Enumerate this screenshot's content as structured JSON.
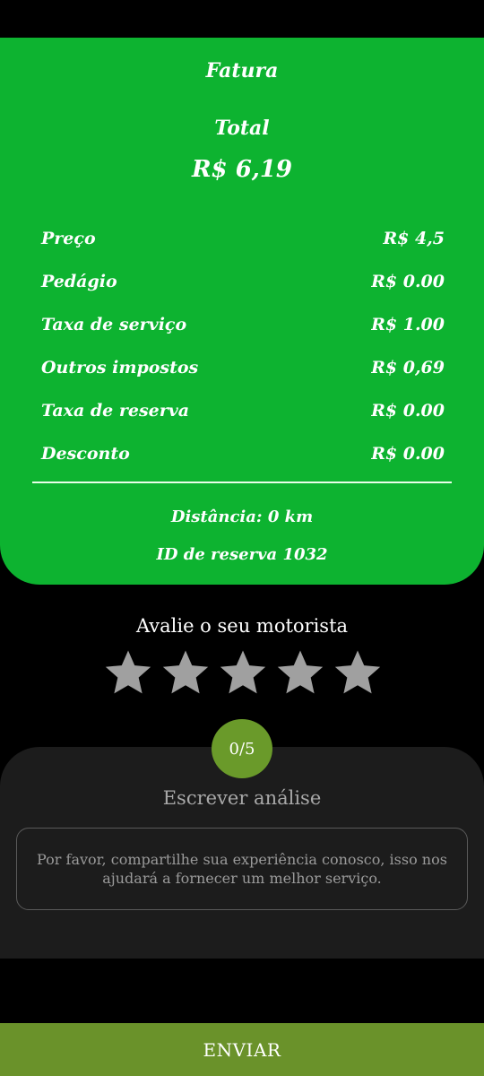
{
  "invoice": {
    "title": "Fatura",
    "total_label": "Total",
    "total_value": "R$ 6,19",
    "rows": [
      {
        "label": "Preço",
        "value": "R$ 4,5"
      },
      {
        "label": "Pedágio",
        "value": "R$ 0.00"
      },
      {
        "label": "Taxa de serviço",
        "value": "R$ 1.00"
      },
      {
        "label": "Outros impostos",
        "value": "R$ 0,69"
      },
      {
        "label": "Taxa de reserva",
        "value": "R$ 0.00"
      },
      {
        "label": "Desconto",
        "value": "R$ 0.00"
      }
    ],
    "distance": "Distância: 0 km",
    "booking_id": "ID de reserva 1032"
  },
  "rating": {
    "title": "Avalie o seu motorista",
    "stars_total": 5,
    "stars_selected": 0,
    "badge": "0/5",
    "star_color": "#a0a0a0"
  },
  "review": {
    "title": "Escrever análise",
    "placeholder": "Por favor, compartilhe sua experiência conosco, isso nos ajudará a fornecer um melhor serviço."
  },
  "submit": {
    "label": "ENVIAR"
  },
  "colors": {
    "invoice_bg": "#0db330",
    "accent": "#6a922a",
    "panel_bg": "#1c1c1c"
  }
}
